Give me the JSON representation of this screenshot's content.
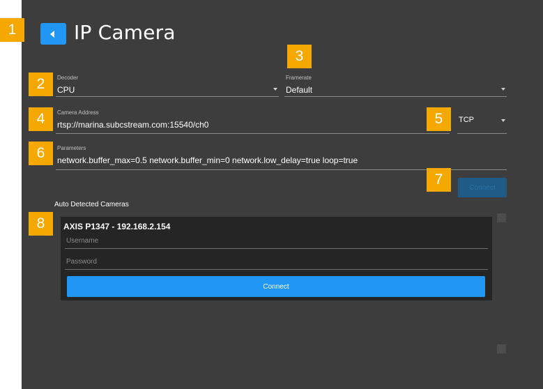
{
  "callouts": [
    "1",
    "2",
    "3",
    "4",
    "5",
    "6",
    "7",
    "8"
  ],
  "header": {
    "title": "IP Camera",
    "back_icon": "chevron-left-icon"
  },
  "decoder": {
    "label": "Decoder",
    "value": "CPU"
  },
  "framerate": {
    "label": "Framerate",
    "value": "Default"
  },
  "camera_address": {
    "label": "Camera Address",
    "value": "rtsp://marina.subcstream.com:15540/ch0"
  },
  "protocol": {
    "value": "TCP"
  },
  "parameters": {
    "label": "Parameters",
    "value": "network.buffer_max=0.5 network.buffer_min=0 network.low_delay=true loop=true"
  },
  "top_connect": {
    "label": "Connect"
  },
  "auto_detected": {
    "section_label": "Auto Detected Cameras",
    "camera": {
      "name": "AXIS P1347  -  192.168.2.154",
      "username_placeholder": "Username",
      "password_placeholder": "Password",
      "connect_label": "Connect"
    }
  },
  "colors": {
    "panel_bg": "#3d3d3d",
    "accent": "#2196f3",
    "callout": "#f5a800",
    "card_bg": "#252525"
  }
}
